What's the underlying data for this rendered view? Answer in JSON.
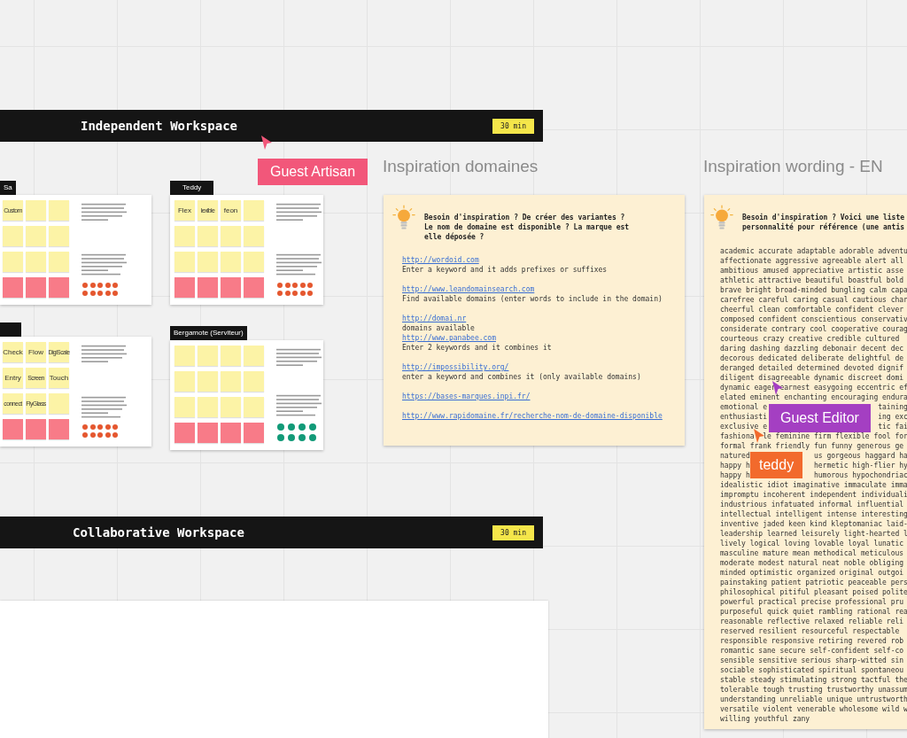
{
  "sections": [
    {
      "title": "Independent Workspace",
      "duration": "30 min"
    },
    {
      "title": "Collaborative Workspace",
      "duration": "30 min"
    }
  ],
  "boards": [
    {
      "owner": "Sa",
      "sticky_rows": [
        [
          {
            "kind": "idea",
            "text": "Custom"
          },
          {
            "kind": "idea"
          },
          {
            "kind": "idea"
          }
        ],
        [
          {
            "kind": "idea"
          },
          {
            "kind": "idea"
          },
          {
            "kind": "idea"
          }
        ],
        [
          {
            "kind": "idea"
          },
          {
            "kind": "idea"
          },
          {
            "kind": "idea"
          }
        ],
        [
          {
            "kind": "avoid"
          },
          {
            "kind": "avoid"
          },
          {
            "kind": "avoid"
          }
        ]
      ],
      "dots": [
        {
          "color": "#e5572f"
        },
        {
          "color": "#e5572f"
        },
        {
          "color": "#e5572f"
        },
        {
          "color": "#e5572f"
        },
        {
          "color": "#e5572f"
        },
        {
          "color": "#e5572f"
        },
        {
          "color": "#e5572f"
        },
        {
          "color": "#e5572f"
        },
        {
          "color": "#e5572f"
        },
        {
          "color": "#e5572f"
        }
      ]
    },
    {
      "owner": "Teddy",
      "sticky_rows": [
        [
          {
            "kind": "idea",
            "text": "Flex"
          },
          {
            "kind": "idea",
            "text": "lexible"
          },
          {
            "kind": "idea",
            "text": "feon"
          },
          {
            "kind": "idea"
          }
        ],
        [
          {
            "kind": "idea"
          },
          {
            "kind": "idea"
          },
          {
            "kind": "idea"
          },
          {
            "kind": "idea"
          }
        ],
        [
          {
            "kind": "idea"
          },
          {
            "kind": "idea"
          },
          {
            "kind": "idea"
          },
          {
            "kind": "idea"
          }
        ],
        [
          {
            "kind": "avoid"
          },
          {
            "kind": "avoid"
          },
          {
            "kind": "avoid"
          },
          {
            "kind": "avoid"
          }
        ]
      ],
      "dots": [
        {
          "color": "#e5572f"
        },
        {
          "color": "#e5572f"
        },
        {
          "color": "#e5572f"
        },
        {
          "color": "#e5572f"
        },
        {
          "color": "#e5572f"
        },
        {
          "color": "#e5572f"
        },
        {
          "color": "#e5572f"
        },
        {
          "color": "#e5572f"
        },
        {
          "color": "#e5572f"
        },
        {
          "color": "#e5572f"
        }
      ]
    },
    {
      "sticky_rows": [
        [
          {
            "kind": "idea",
            "text": "Check"
          },
          {
            "kind": "idea",
            "text": "Flow"
          },
          {
            "kind": "idea",
            "text": "DigiScale"
          }
        ],
        [
          {
            "kind": "idea",
            "text": "Entry"
          },
          {
            "kind": "idea",
            "text": "Screen"
          },
          {
            "kind": "idea",
            "text": "Touch"
          }
        ],
        [
          {
            "kind": "idea",
            "text": "connect"
          },
          {
            "kind": "idea",
            "text": "FlyGlass"
          },
          {
            "kind": "idea"
          }
        ],
        [
          {
            "kind": "avoid"
          },
          {
            "kind": "avoid"
          },
          {
            "kind": "avoid"
          }
        ]
      ],
      "dots": [
        {
          "color": "#e5572f"
        },
        {
          "color": "#e5572f"
        },
        {
          "color": "#e5572f"
        },
        {
          "color": "#e5572f"
        },
        {
          "color": "#e5572f"
        },
        {
          "color": "#e5572f"
        },
        {
          "color": "#e5572f"
        },
        {
          "color": "#e5572f"
        },
        {
          "color": "#e5572f"
        },
        {
          "color": "#e5572f"
        }
      ]
    },
    {
      "owner": "Bergamote (Serviteur)",
      "sticky_rows": [
        [
          {
            "kind": "idea"
          },
          {
            "kind": "idea"
          },
          {
            "kind": "idea"
          },
          {
            "kind": "idea"
          }
        ],
        [
          {
            "kind": "idea"
          },
          {
            "kind": "idea"
          },
          {
            "kind": "idea"
          },
          {
            "kind": "idea"
          }
        ],
        [
          {
            "kind": "idea"
          },
          {
            "kind": "idea"
          },
          {
            "kind": "idea"
          },
          {
            "kind": "idea"
          }
        ],
        [
          {
            "kind": "avoid"
          },
          {
            "kind": "avoid"
          },
          {
            "kind": "avoid"
          },
          {
            "kind": "avoid"
          }
        ]
      ],
      "dots": [
        {
          "color": "#129a78"
        },
        {
          "color": "#129a78"
        },
        {
          "color": "#129a78"
        },
        {
          "color": "#129a78"
        },
        {
          "color": "#129a78"
        },
        {
          "color": "#129a78"
        },
        {
          "color": "#129a78"
        },
        {
          "color": "#129a78"
        }
      ]
    }
  ],
  "inspiration_cards": [
    {
      "heading": "Inspiration domaines",
      "intro_lines": [
        "Besoin d'inspiration ? De créer des variantes ?",
        "Le nom de domaine est disponible ? La marque est",
        "elle déposée ?"
      ],
      "entries": [
        {
          "kind": "link",
          "text": "http://wordoid.com"
        },
        {
          "kind": "text",
          "text": "Enter a keyword and it adds prefixes or suffixes"
        },
        {
          "kind": "gap"
        },
        {
          "kind": "link",
          "text": "http://www.leandomainsearch.com"
        },
        {
          "kind": "text",
          "text": "Find available domains (enter words to include in the domain)"
        },
        {
          "kind": "gap"
        },
        {
          "kind": "link",
          "text": "http://domai.nr"
        },
        {
          "kind": "text",
          "text": "domains available"
        },
        {
          "kind": "link",
          "text": "http://www.panabee.com"
        },
        {
          "kind": "text",
          "text": "Enter 2 keywords and it combines it"
        },
        {
          "kind": "gap"
        },
        {
          "kind": "link",
          "text": "http://impossibility.org/"
        },
        {
          "kind": "text",
          "text": "enter a keyword and combines it (only available domains)"
        },
        {
          "kind": "gap"
        },
        {
          "kind": "link",
          "text": "https://bases-marques.inpi.fr/"
        },
        {
          "kind": "gap"
        },
        {
          "kind": "link",
          "text": "http://www.rapidomaine.fr/recherche-nom-de-domaine-disponible"
        }
      ]
    },
    {
      "heading": "Inspiration wording - EN",
      "intro_lines": [
        "Besoin d'inspiration ? Voici une liste",
        "personnalité pour référence (une antis"
      ],
      "entries": [
        {
          "kind": "text",
          "text": "academic accurate adaptable adorable adventu"
        },
        {
          "kind": "text",
          "text": "affectionate aggressive agreeable alert all"
        },
        {
          "kind": "text",
          "text": "ambitious amused appreciative artistic asse"
        },
        {
          "kind": "text",
          "text": "athletic attractive beautiful boastful bold"
        },
        {
          "kind": "text",
          "text": "brave bright broad-minded bungling calm capa"
        },
        {
          "kind": "text",
          "text": "carefree careful caring casual cautious char"
        },
        {
          "kind": "text",
          "text": "cheerful clean comfortable confident clever"
        },
        {
          "kind": "text",
          "text": "composed confident conscientious conservativ"
        },
        {
          "kind": "text",
          "text": "considerate contrary cool cooperative courag"
        },
        {
          "kind": "text",
          "text": "courteous crazy creative credible cultured"
        },
        {
          "kind": "text",
          "text": "daring dashing dazzling debonair decent dec"
        },
        {
          "kind": "text",
          "text": "decorous dedicated deliberate delightful de"
        },
        {
          "kind": "text",
          "text": "deranged detailed determined devoted dignif"
        },
        {
          "kind": "text",
          "text": "diligent disagreeable dynamic discreet domi"
        },
        {
          "kind": "text",
          "text": "dynamic eager earnest easygoing eccentric ef"
        },
        {
          "kind": "text",
          "text": "elated eminent enchanting encouraging endura"
        },
        {
          "kind": "text",
          "text": "emotional e",
          "after": "taining"
        },
        {
          "kind": "text",
          "text": "enthusiasti",
          "after": "ing exc"
        },
        {
          "kind": "text",
          "text": "exclusive e",
          "after": "tic fai"
        },
        {
          "kind": "text",
          "text": "fashiona",
          "after": "le feminine firm flexible fool for"
        },
        {
          "kind": "text",
          "text": "formal frank friendly fun funny generous ge"
        },
        {
          "kind": "text",
          "text": "natured",
          "after": "us gorgeous haggard ha"
        },
        {
          "kind": "text",
          "text": "happy h",
          "after": "hermetic high-flier hy"
        },
        {
          "kind": "text",
          "text": "happy h",
          "after": "humorous hypochondriac"
        },
        {
          "kind": "text",
          "text": "idealistic idiot imaginative immaculate imma"
        },
        {
          "kind": "text",
          "text": "impromptu incoherent independent individuali"
        },
        {
          "kind": "text",
          "text": "industrious infatuated informal influential"
        },
        {
          "kind": "text",
          "text": "intellectual intelligent intense interesting"
        },
        {
          "kind": "text",
          "text": "inventive jaded keen kind kleptomaniac laid-"
        },
        {
          "kind": "text",
          "text": "leadership learned leisurely light-hearted l"
        },
        {
          "kind": "text",
          "text": "lively logical loving lovable loyal lunatic"
        },
        {
          "kind": "text",
          "text": "masculine mature mean methodical meticulous"
        },
        {
          "kind": "text",
          "text": "moderate modest natural neat noble obliging"
        },
        {
          "kind": "text",
          "text": "minded optimistic organized original outgoi"
        },
        {
          "kind": "text",
          "text": "painstaking patient patriotic peaceable pers"
        },
        {
          "kind": "text",
          "text": "philosophical pitiful pleasant poised polite"
        },
        {
          "kind": "text",
          "text": "powerful practical precise professional pru"
        },
        {
          "kind": "text",
          "text": "purposeful quick quiet rambling rational rea"
        },
        {
          "kind": "text",
          "text": "reasonable reflective relaxed reliable reli"
        },
        {
          "kind": "text",
          "text": "reserved resilient resourceful respectable"
        },
        {
          "kind": "text",
          "text": "responsible responsive retiring revered rob"
        },
        {
          "kind": "text",
          "text": "romantic sane secure self-confident self-co"
        },
        {
          "kind": "text",
          "text": "sensible sensitive serious sharp-witted sin"
        },
        {
          "kind": "text",
          "text": "sociable sophisticated spiritual spontaneou"
        },
        {
          "kind": "text",
          "text": "stable steady stimulating strong tactful the"
        },
        {
          "kind": "text",
          "text": "tolerable tough trusting trustworthy unassum"
        },
        {
          "kind": "text",
          "text": "understanding unreliable unique untrustworth"
        },
        {
          "kind": "text",
          "text": "versatile violent venerable wholesome wild w"
        },
        {
          "kind": "text",
          "text": "willing youthful zany"
        }
      ]
    }
  ],
  "cursors": [
    {
      "name": "Guest Artisan",
      "color": "#f2577a"
    },
    {
      "name": "Guest Editor",
      "color": "#a43fc2"
    },
    {
      "name": "teddy",
      "color": "#f26a2c"
    }
  ]
}
